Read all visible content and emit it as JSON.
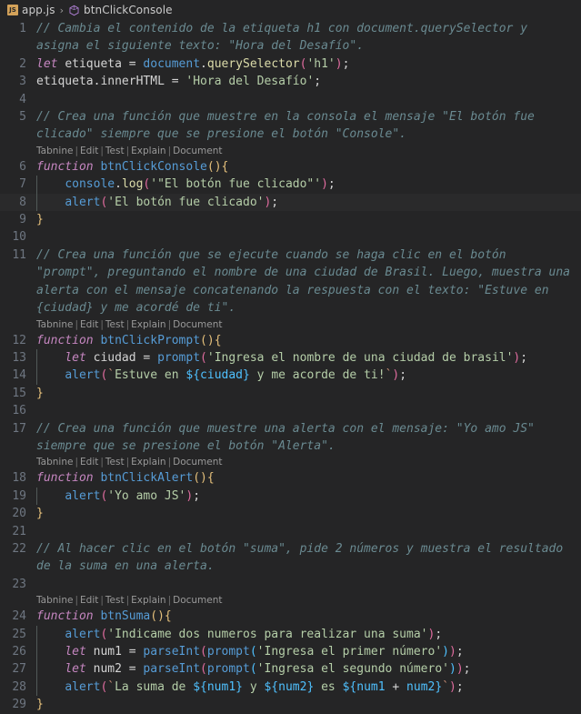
{
  "breadcrumb": {
    "file_icon": "js-file-icon",
    "file_name": "app.js",
    "separator": "›",
    "symbol_icon": "method-symbol-icon",
    "symbol_name": "btnClickConsole"
  },
  "codelens": {
    "items": [
      "Tabnine",
      "Edit",
      "Test",
      "Explain",
      "Document"
    ],
    "separator": "|"
  },
  "colors": {
    "editor_background": "#252526",
    "current_line_background": "#2a2a2b",
    "line_number": "#6e7681",
    "comment": "#6a8a91",
    "keyword": "#c586c0",
    "function_name": "#569cd6",
    "method": "#dcdcaa",
    "string": "#b5cea8",
    "bracket_magenta": "#e06c9f",
    "bracket_blue": "#4fc1ff",
    "bracket_yellow": "#e5c07b",
    "text": "#d4d4d4",
    "codelens_text": "#999999",
    "js_icon": "#d4a259",
    "symbol_icon": "#b180d7"
  },
  "editor": {
    "language": "javascript",
    "current_line": 8,
    "total_lines_shown": 29,
    "rows": [
      {
        "type": "code",
        "number": "1",
        "indented": false,
        "tokens": [
          {
            "c": "t-comment",
            "t": "// Cambia el contenido de la etiqueta h1 con document.querySelector y asigna el siguiente texto: \"Hora del Desafío\"."
          }
        ]
      },
      {
        "type": "code",
        "number": "2",
        "indented": false,
        "tokens": [
          {
            "c": "t-keyword",
            "t": "let"
          },
          {
            "c": "t-plain",
            "t": " "
          },
          {
            "c": "t-var",
            "t": "etiqueta"
          },
          {
            "c": "t-op",
            "t": " = "
          },
          {
            "c": "t-func",
            "t": "document"
          },
          {
            "c": "t-plain",
            "t": "."
          },
          {
            "c": "t-method",
            "t": "querySelector"
          },
          {
            "c": "t-p1",
            "t": "("
          },
          {
            "c": "t-string",
            "t": "'h1'"
          },
          {
            "c": "t-p1",
            "t": ")"
          },
          {
            "c": "t-semi",
            "t": ";"
          }
        ]
      },
      {
        "type": "code",
        "number": "3",
        "indented": false,
        "tokens": [
          {
            "c": "t-var",
            "t": "etiqueta"
          },
          {
            "c": "t-plain",
            "t": "."
          },
          {
            "c": "t-var",
            "t": "innerHTML"
          },
          {
            "c": "t-op",
            "t": " = "
          },
          {
            "c": "t-string",
            "t": "'Hora del Desafío'"
          },
          {
            "c": "t-semi",
            "t": ";"
          }
        ]
      },
      {
        "type": "code",
        "number": "4",
        "indented": false,
        "tokens": []
      },
      {
        "type": "code",
        "number": "5",
        "indented": false,
        "tokens": [
          {
            "c": "t-comment",
            "t": "// Crea una función que muestre en la consola el mensaje \"El botón fue clicado\" siempre que se presione el botón \"Console\"."
          }
        ]
      },
      {
        "type": "codelens"
      },
      {
        "type": "code",
        "number": "6",
        "indented": false,
        "tokens": [
          {
            "c": "t-keyword",
            "t": "function"
          },
          {
            "c": "t-plain",
            "t": " "
          },
          {
            "c": "t-func",
            "t": "btnClickConsole"
          },
          {
            "c": "t-p3",
            "t": "("
          },
          {
            "c": "t-p3",
            "t": ")"
          },
          {
            "c": "t-brace",
            "t": "{"
          }
        ]
      },
      {
        "type": "code",
        "number": "7",
        "indented": true,
        "tokens": [
          {
            "c": "t-plain",
            "t": "    "
          },
          {
            "c": "t-func",
            "t": "console"
          },
          {
            "c": "t-plain",
            "t": "."
          },
          {
            "c": "t-method",
            "t": "log"
          },
          {
            "c": "t-p1",
            "t": "("
          },
          {
            "c": "t-string",
            "t": "'\"El botón fue clicado\"'"
          },
          {
            "c": "t-p1",
            "t": ")"
          },
          {
            "c": "t-semi",
            "t": ";"
          }
        ]
      },
      {
        "type": "code",
        "number": "8",
        "indented": true,
        "current": true,
        "tokens": [
          {
            "c": "t-plain",
            "t": "    "
          },
          {
            "c": "t-func",
            "t": "alert"
          },
          {
            "c": "t-p1",
            "t": "("
          },
          {
            "c": "t-string",
            "t": "'El botón fue clicado'"
          },
          {
            "c": "t-p1",
            "t": ")"
          },
          {
            "c": "t-semi",
            "t": ";"
          }
        ]
      },
      {
        "type": "code",
        "number": "9",
        "indented": false,
        "tokens": [
          {
            "c": "t-brace",
            "t": "}"
          }
        ]
      },
      {
        "type": "code",
        "number": "10",
        "indented": false,
        "tokens": []
      },
      {
        "type": "code",
        "number": "11",
        "indented": false,
        "tokens": [
          {
            "c": "t-comment",
            "t": "// Crea una función que se ejecute cuando se haga clic en el botón \"prompt\", preguntando el nombre de una ciudad de Brasil. Luego, muestra una alerta con el mensaje concatenando la respuesta con el texto: \"Estuve en {ciudad} y me acordé de ti\"."
          }
        ]
      },
      {
        "type": "codelens"
      },
      {
        "type": "code",
        "number": "12",
        "indented": false,
        "tokens": [
          {
            "c": "t-keyword",
            "t": "function"
          },
          {
            "c": "t-plain",
            "t": " "
          },
          {
            "c": "t-func",
            "t": "btnClickPrompt"
          },
          {
            "c": "t-p3",
            "t": "("
          },
          {
            "c": "t-p3",
            "t": ")"
          },
          {
            "c": "t-brace",
            "t": "{"
          }
        ]
      },
      {
        "type": "code",
        "number": "13",
        "indented": true,
        "tokens": [
          {
            "c": "t-plain",
            "t": "    "
          },
          {
            "c": "t-keyword",
            "t": "let"
          },
          {
            "c": "t-plain",
            "t": " "
          },
          {
            "c": "t-var",
            "t": "ciudad"
          },
          {
            "c": "t-op",
            "t": " = "
          },
          {
            "c": "t-func",
            "t": "prompt"
          },
          {
            "c": "t-p1",
            "t": "("
          },
          {
            "c": "t-string",
            "t": "'Ingresa el nombre de una ciudad de brasil'"
          },
          {
            "c": "t-p1",
            "t": ")"
          },
          {
            "c": "t-semi",
            "t": ";"
          }
        ]
      },
      {
        "type": "code",
        "number": "14",
        "indented": true,
        "tokens": [
          {
            "c": "t-plain",
            "t": "    "
          },
          {
            "c": "t-func",
            "t": "alert"
          },
          {
            "c": "t-p1",
            "t": "("
          },
          {
            "c": "t-tpl",
            "t": "`"
          },
          {
            "c": "t-string",
            "t": "Estuve en "
          },
          {
            "c": "t-interp",
            "t": "${"
          },
          {
            "c": "t-p2",
            "t": "ciudad"
          },
          {
            "c": "t-interp",
            "t": "}"
          },
          {
            "c": "t-string",
            "t": " y me acorde de ti!"
          },
          {
            "c": "t-tpl",
            "t": "`"
          },
          {
            "c": "t-p1",
            "t": ")"
          },
          {
            "c": "t-semi",
            "t": ";"
          }
        ]
      },
      {
        "type": "code",
        "number": "15",
        "indented": false,
        "tokens": [
          {
            "c": "t-brace",
            "t": "}"
          }
        ]
      },
      {
        "type": "code",
        "number": "16",
        "indented": false,
        "tokens": []
      },
      {
        "type": "code",
        "number": "17",
        "indented": false,
        "tokens": [
          {
            "c": "t-comment",
            "t": "// Crea una función que muestre una alerta con el mensaje: \"Yo amo JS\" siempre que se presione el botón \"Alerta\"."
          }
        ]
      },
      {
        "type": "codelens"
      },
      {
        "type": "code",
        "number": "18",
        "indented": false,
        "tokens": [
          {
            "c": "t-keyword",
            "t": "function"
          },
          {
            "c": "t-plain",
            "t": " "
          },
          {
            "c": "t-func",
            "t": "btnClickAlert"
          },
          {
            "c": "t-p3",
            "t": "("
          },
          {
            "c": "t-p3",
            "t": ")"
          },
          {
            "c": "t-brace",
            "t": "{"
          }
        ]
      },
      {
        "type": "code",
        "number": "19",
        "indented": true,
        "tokens": [
          {
            "c": "t-plain",
            "t": "    "
          },
          {
            "c": "t-func",
            "t": "alert"
          },
          {
            "c": "t-p1",
            "t": "("
          },
          {
            "c": "t-string",
            "t": "'Yo amo JS'"
          },
          {
            "c": "t-p1",
            "t": ")"
          },
          {
            "c": "t-semi",
            "t": ";"
          }
        ]
      },
      {
        "type": "code",
        "number": "20",
        "indented": false,
        "tokens": [
          {
            "c": "t-brace",
            "t": "}"
          }
        ]
      },
      {
        "type": "code",
        "number": "21",
        "indented": false,
        "tokens": []
      },
      {
        "type": "code",
        "number": "22",
        "indented": false,
        "tokens": [
          {
            "c": "t-comment",
            "t": "// Al hacer clic en el botón \"suma\", pide 2 números y muestra el resultado de la suma en una alerta."
          }
        ]
      },
      {
        "type": "code",
        "number": "23",
        "indented": false,
        "tokens": []
      },
      {
        "type": "codelens"
      },
      {
        "type": "code",
        "number": "24",
        "indented": false,
        "tokens": [
          {
            "c": "t-keyword",
            "t": "function"
          },
          {
            "c": "t-plain",
            "t": " "
          },
          {
            "c": "t-func",
            "t": "btnSuma"
          },
          {
            "c": "t-p3",
            "t": "("
          },
          {
            "c": "t-p3",
            "t": ")"
          },
          {
            "c": "t-brace",
            "t": "{"
          }
        ]
      },
      {
        "type": "code",
        "number": "25",
        "indented": true,
        "tokens": [
          {
            "c": "t-plain",
            "t": "    "
          },
          {
            "c": "t-func",
            "t": "alert"
          },
          {
            "c": "t-p1",
            "t": "("
          },
          {
            "c": "t-string",
            "t": "'Indicame dos numeros para realizar una suma'"
          },
          {
            "c": "t-p1",
            "t": ")"
          },
          {
            "c": "t-semi",
            "t": ";"
          }
        ]
      },
      {
        "type": "code",
        "number": "26",
        "indented": true,
        "tokens": [
          {
            "c": "t-plain",
            "t": "    "
          },
          {
            "c": "t-keyword",
            "t": "let"
          },
          {
            "c": "t-plain",
            "t": " "
          },
          {
            "c": "t-var",
            "t": "num1"
          },
          {
            "c": "t-op",
            "t": " = "
          },
          {
            "c": "t-func",
            "t": "parseInt"
          },
          {
            "c": "t-p1",
            "t": "("
          },
          {
            "c": "t-func",
            "t": "prompt"
          },
          {
            "c": "t-p2",
            "t": "("
          },
          {
            "c": "t-string",
            "t": "'Ingresa el primer número'"
          },
          {
            "c": "t-p2",
            "t": ")"
          },
          {
            "c": "t-p1",
            "t": ")"
          },
          {
            "c": "t-semi",
            "t": ";"
          }
        ]
      },
      {
        "type": "code",
        "number": "27",
        "indented": true,
        "tokens": [
          {
            "c": "t-plain",
            "t": "    "
          },
          {
            "c": "t-keyword",
            "t": "let"
          },
          {
            "c": "t-plain",
            "t": " "
          },
          {
            "c": "t-var",
            "t": "num2"
          },
          {
            "c": "t-op",
            "t": " = "
          },
          {
            "c": "t-func",
            "t": "parseInt"
          },
          {
            "c": "t-p1",
            "t": "("
          },
          {
            "c": "t-func",
            "t": "prompt"
          },
          {
            "c": "t-p2",
            "t": "("
          },
          {
            "c": "t-string",
            "t": "'Ingresa el segundo número'"
          },
          {
            "c": "t-p2",
            "t": ")"
          },
          {
            "c": "t-p1",
            "t": ")"
          },
          {
            "c": "t-semi",
            "t": ";"
          }
        ]
      },
      {
        "type": "code",
        "number": "28",
        "indented": true,
        "tokens": [
          {
            "c": "t-plain",
            "t": "    "
          },
          {
            "c": "t-func",
            "t": "alert"
          },
          {
            "c": "t-p1",
            "t": "("
          },
          {
            "c": "t-tpl",
            "t": "`"
          },
          {
            "c": "t-string",
            "t": "La suma de "
          },
          {
            "c": "t-interp",
            "t": "${"
          },
          {
            "c": "t-p2",
            "t": "num1"
          },
          {
            "c": "t-interp",
            "t": "}"
          },
          {
            "c": "t-string",
            "t": " y "
          },
          {
            "c": "t-interp",
            "t": "${"
          },
          {
            "c": "t-p2",
            "t": "num2"
          },
          {
            "c": "t-interp",
            "t": "}"
          },
          {
            "c": "t-string",
            "t": " es "
          },
          {
            "c": "t-interp",
            "t": "${"
          },
          {
            "c": "t-p2",
            "t": "num1"
          },
          {
            "c": "t-op",
            "t": " + "
          },
          {
            "c": "t-p2",
            "t": "num2"
          },
          {
            "c": "t-interp",
            "t": "}"
          },
          {
            "c": "t-tpl",
            "t": "`"
          },
          {
            "c": "t-p1",
            "t": ")"
          },
          {
            "c": "t-semi",
            "t": ";"
          }
        ]
      },
      {
        "type": "code",
        "number": "29",
        "indented": false,
        "tokens": [
          {
            "c": "t-brace",
            "t": "}"
          }
        ]
      }
    ]
  }
}
